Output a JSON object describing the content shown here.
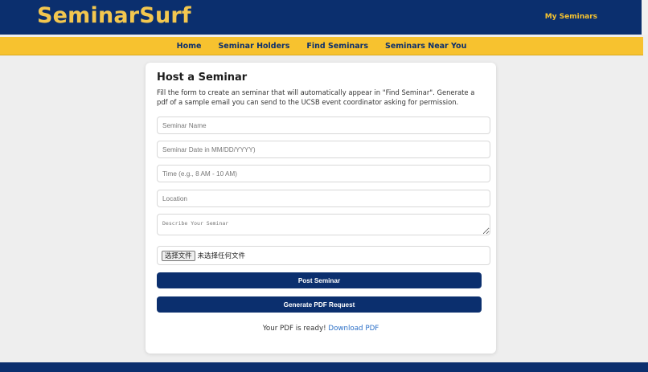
{
  "header": {
    "logo": "SeminarSurf",
    "my_seminars": "My Seminars"
  },
  "nav": {
    "items": [
      {
        "label": "Home"
      },
      {
        "label": "Seminar Holders"
      },
      {
        "label": "Find Seminars"
      },
      {
        "label": "Seminars Near You"
      }
    ]
  },
  "form": {
    "title": "Host a Seminar",
    "description": "Fill the form to create an seminar that will automatically appear in \"Find Seminar\". Generate a pdf of a sample email you can send to the UCSB event coordinator asking for permission.",
    "name_placeholder": "Seminar Name",
    "date_placeholder": "Seminar Date in MM/DD/YYYY)",
    "time_placeholder": "Time (e.g., 8 AM - 10 AM)",
    "location_placeholder": "Location",
    "describe_placeholder": "Describe Your Seminar",
    "file_button": "选择文件",
    "file_status": "未选择任何文件",
    "post_button": "Post Seminar",
    "pdf_button": "Generate PDF Request",
    "pdf_ready_text": "Your PDF is ready! ",
    "download_link": "Download PDF"
  },
  "colors": {
    "navy": "#0b2f6e",
    "gold": "#f7c22f",
    "link": "#2b6fc7"
  }
}
